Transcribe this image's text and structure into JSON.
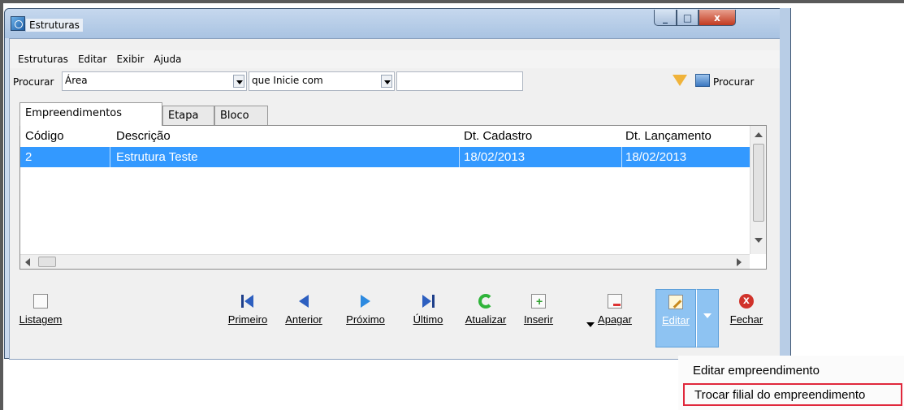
{
  "window": {
    "title": "Estruturas"
  },
  "menubar": [
    "Estruturas",
    "Editar",
    "Exibir",
    "Ajuda"
  ],
  "search": {
    "label": "Procurar",
    "field": "Área",
    "mode": "que Inicie com",
    "value": "",
    "search_button": "Procurar"
  },
  "tabs": [
    "Empreendimentos",
    "Etapa",
    "Bloco"
  ],
  "grid": {
    "columns": [
      "Código",
      "Descrição",
      "Dt. Cadastro",
      "Dt. Lançamento"
    ],
    "rows": [
      {
        "codigo": "2",
        "descricao": "Estrutura Teste",
        "cadastro": "18/02/2013",
        "lancamento": "18/02/2013",
        "selected": true
      }
    ]
  },
  "toolbar": {
    "listagem": "Listagem",
    "primeiro": "Primeiro",
    "anterior": "Anterior",
    "proximo": "Próximo",
    "ultimo": "Último",
    "atualizar": "Atualizar",
    "inserir": "Inserir",
    "apagar": "Apagar",
    "editar": "Editar",
    "fechar": "Fechar"
  },
  "dropdown": [
    "Editar empreendimento",
    "Trocar filial do empreendimento"
  ],
  "colors": {
    "selection": "#3399ff",
    "highlight_border": "#e0283c",
    "edit_active": "#8ec3f2"
  }
}
